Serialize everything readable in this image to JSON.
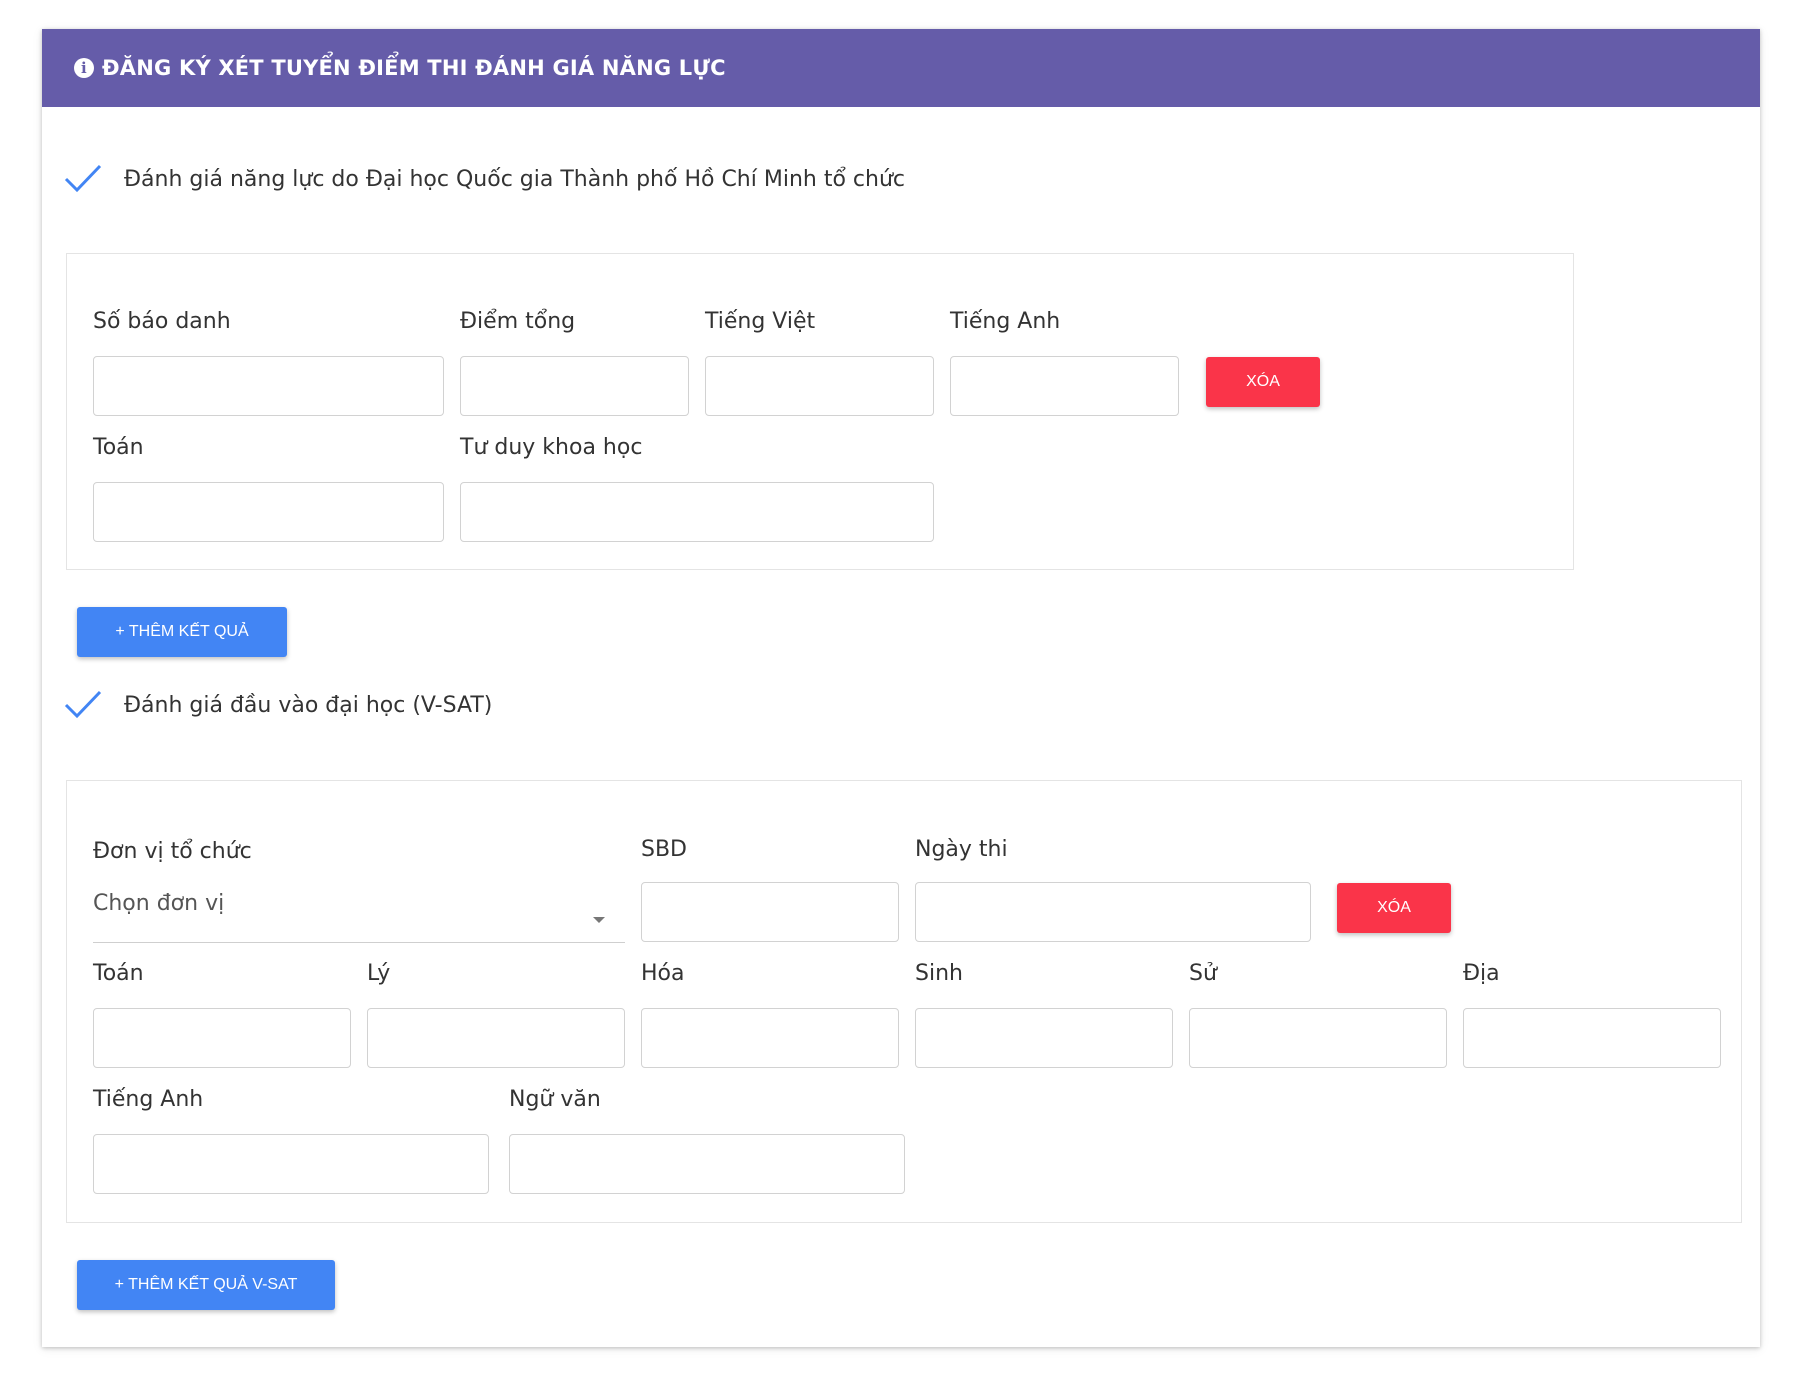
{
  "header": {
    "title": "ĐĂNG KÝ XÉT TUYỂN ĐIỂM THI ĐÁNH GIÁ NĂNG LỰC",
    "icon": "info-circle-icon"
  },
  "colors": {
    "header_bg": "#655ca9",
    "check": "#4285f4",
    "delete_btn": "#fa3449",
    "add_btn": "#4285f4"
  },
  "section1": {
    "checked": true,
    "label": "Đánh giá năng lực do Đại học Quốc gia Thành phố Hồ Chí Minh tổ chức",
    "fields": {
      "so_bao_danh": {
        "label": "Số báo danh",
        "value": ""
      },
      "diem_tong": {
        "label": "Điểm tổng",
        "value": ""
      },
      "tieng_viet": {
        "label": "Tiếng Việt",
        "value": ""
      },
      "tieng_anh": {
        "label": "Tiếng Anh",
        "value": ""
      },
      "toan": {
        "label": "Toán",
        "value": ""
      },
      "tu_duy": {
        "label": "Tư duy khoa học",
        "value": ""
      }
    },
    "delete_label": "XÓA",
    "add_label": "+ THÊM KẾT QUẢ"
  },
  "section2": {
    "checked": true,
    "label": "Đánh giá đầu vào đại học (V-SAT)",
    "fields": {
      "don_vi": {
        "label": "Đơn vị tổ chức",
        "placeholder": "Chọn đơn vị"
      },
      "sbd": {
        "label": "SBD",
        "value": ""
      },
      "ngay_thi": {
        "label": "Ngày thi",
        "value": ""
      },
      "toan": {
        "label": "Toán",
        "value": ""
      },
      "ly": {
        "label": "Lý",
        "value": ""
      },
      "hoa": {
        "label": "Hóa",
        "value": ""
      },
      "sinh": {
        "label": "Sinh",
        "value": ""
      },
      "su": {
        "label": "Sử",
        "value": ""
      },
      "dia": {
        "label": "Địa",
        "value": ""
      },
      "tieng_anh": {
        "label": "Tiếng Anh",
        "value": ""
      },
      "ngu_van": {
        "label": "Ngữ văn",
        "value": ""
      }
    },
    "delete_label": "XÓA",
    "add_label": "+ THÊM KẾT QUẢ V-SAT"
  }
}
